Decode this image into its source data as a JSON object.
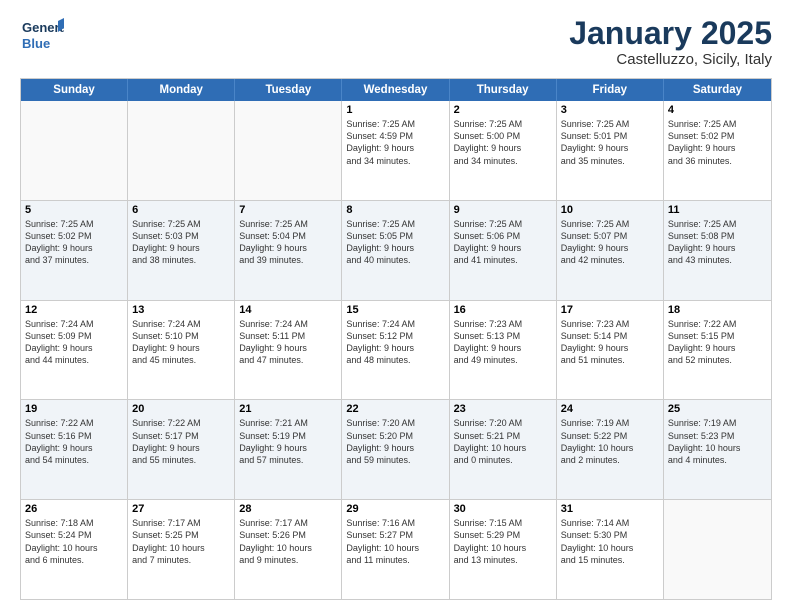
{
  "logo": {
    "line1": "General",
    "line2": "Blue"
  },
  "title": "January 2025",
  "subtitle": "Castelluzzo, Sicily, Italy",
  "header_days": [
    "Sunday",
    "Monday",
    "Tuesday",
    "Wednesday",
    "Thursday",
    "Friday",
    "Saturday"
  ],
  "weeks": [
    [
      {
        "day": "",
        "info": ""
      },
      {
        "day": "",
        "info": ""
      },
      {
        "day": "",
        "info": ""
      },
      {
        "day": "1",
        "info": "Sunrise: 7:25 AM\nSunset: 4:59 PM\nDaylight: 9 hours\nand 34 minutes."
      },
      {
        "day": "2",
        "info": "Sunrise: 7:25 AM\nSunset: 5:00 PM\nDaylight: 9 hours\nand 34 minutes."
      },
      {
        "day": "3",
        "info": "Sunrise: 7:25 AM\nSunset: 5:01 PM\nDaylight: 9 hours\nand 35 minutes."
      },
      {
        "day": "4",
        "info": "Sunrise: 7:25 AM\nSunset: 5:02 PM\nDaylight: 9 hours\nand 36 minutes."
      }
    ],
    [
      {
        "day": "5",
        "info": "Sunrise: 7:25 AM\nSunset: 5:02 PM\nDaylight: 9 hours\nand 37 minutes."
      },
      {
        "day": "6",
        "info": "Sunrise: 7:25 AM\nSunset: 5:03 PM\nDaylight: 9 hours\nand 38 minutes."
      },
      {
        "day": "7",
        "info": "Sunrise: 7:25 AM\nSunset: 5:04 PM\nDaylight: 9 hours\nand 39 minutes."
      },
      {
        "day": "8",
        "info": "Sunrise: 7:25 AM\nSunset: 5:05 PM\nDaylight: 9 hours\nand 40 minutes."
      },
      {
        "day": "9",
        "info": "Sunrise: 7:25 AM\nSunset: 5:06 PM\nDaylight: 9 hours\nand 41 minutes."
      },
      {
        "day": "10",
        "info": "Sunrise: 7:25 AM\nSunset: 5:07 PM\nDaylight: 9 hours\nand 42 minutes."
      },
      {
        "day": "11",
        "info": "Sunrise: 7:25 AM\nSunset: 5:08 PM\nDaylight: 9 hours\nand 43 minutes."
      }
    ],
    [
      {
        "day": "12",
        "info": "Sunrise: 7:24 AM\nSunset: 5:09 PM\nDaylight: 9 hours\nand 44 minutes."
      },
      {
        "day": "13",
        "info": "Sunrise: 7:24 AM\nSunset: 5:10 PM\nDaylight: 9 hours\nand 45 minutes."
      },
      {
        "day": "14",
        "info": "Sunrise: 7:24 AM\nSunset: 5:11 PM\nDaylight: 9 hours\nand 47 minutes."
      },
      {
        "day": "15",
        "info": "Sunrise: 7:24 AM\nSunset: 5:12 PM\nDaylight: 9 hours\nand 48 minutes."
      },
      {
        "day": "16",
        "info": "Sunrise: 7:23 AM\nSunset: 5:13 PM\nDaylight: 9 hours\nand 49 minutes."
      },
      {
        "day": "17",
        "info": "Sunrise: 7:23 AM\nSunset: 5:14 PM\nDaylight: 9 hours\nand 51 minutes."
      },
      {
        "day": "18",
        "info": "Sunrise: 7:22 AM\nSunset: 5:15 PM\nDaylight: 9 hours\nand 52 minutes."
      }
    ],
    [
      {
        "day": "19",
        "info": "Sunrise: 7:22 AM\nSunset: 5:16 PM\nDaylight: 9 hours\nand 54 minutes."
      },
      {
        "day": "20",
        "info": "Sunrise: 7:22 AM\nSunset: 5:17 PM\nDaylight: 9 hours\nand 55 minutes."
      },
      {
        "day": "21",
        "info": "Sunrise: 7:21 AM\nSunset: 5:19 PM\nDaylight: 9 hours\nand 57 minutes."
      },
      {
        "day": "22",
        "info": "Sunrise: 7:20 AM\nSunset: 5:20 PM\nDaylight: 9 hours\nand 59 minutes."
      },
      {
        "day": "23",
        "info": "Sunrise: 7:20 AM\nSunset: 5:21 PM\nDaylight: 10 hours\nand 0 minutes."
      },
      {
        "day": "24",
        "info": "Sunrise: 7:19 AM\nSunset: 5:22 PM\nDaylight: 10 hours\nand 2 minutes."
      },
      {
        "day": "25",
        "info": "Sunrise: 7:19 AM\nSunset: 5:23 PM\nDaylight: 10 hours\nand 4 minutes."
      }
    ],
    [
      {
        "day": "26",
        "info": "Sunrise: 7:18 AM\nSunset: 5:24 PM\nDaylight: 10 hours\nand 6 minutes."
      },
      {
        "day": "27",
        "info": "Sunrise: 7:17 AM\nSunset: 5:25 PM\nDaylight: 10 hours\nand 7 minutes."
      },
      {
        "day": "28",
        "info": "Sunrise: 7:17 AM\nSunset: 5:26 PM\nDaylight: 10 hours\nand 9 minutes."
      },
      {
        "day": "29",
        "info": "Sunrise: 7:16 AM\nSunset: 5:27 PM\nDaylight: 10 hours\nand 11 minutes."
      },
      {
        "day": "30",
        "info": "Sunrise: 7:15 AM\nSunset: 5:29 PM\nDaylight: 10 hours\nand 13 minutes."
      },
      {
        "day": "31",
        "info": "Sunrise: 7:14 AM\nSunset: 5:30 PM\nDaylight: 10 hours\nand 15 minutes."
      },
      {
        "day": "",
        "info": ""
      }
    ]
  ]
}
